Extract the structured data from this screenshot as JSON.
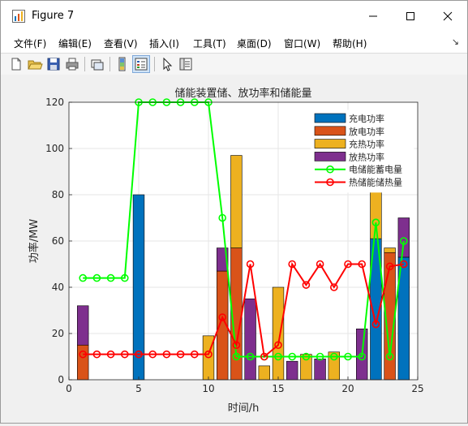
{
  "window": {
    "title": "Figure 7",
    "minimize": "minimize",
    "maximize": "maximize",
    "close": "close"
  },
  "menu": [
    {
      "label": "文件(F)"
    },
    {
      "label": "编辑(E)"
    },
    {
      "label": "查看(V)"
    },
    {
      "label": "插入(I)"
    },
    {
      "label": "工具(T)"
    },
    {
      "label": "桌面(D)"
    },
    {
      "label": "窗口(W)"
    },
    {
      "label": "帮助(H)"
    }
  ],
  "toolbar": [
    {
      "name": "new-figure-icon"
    },
    {
      "name": "open-file-icon"
    },
    {
      "name": "save-icon"
    },
    {
      "name": "print-icon"
    },
    {
      "name": "link-plot-icon"
    },
    {
      "name": "insert-colorbar-icon"
    },
    {
      "name": "insert-legend-icon"
    },
    {
      "name": "edit-plot-icon"
    },
    {
      "name": "property-inspector-icon"
    }
  ],
  "colors": {
    "charge_power": "#0072BD",
    "discharge_power": "#D95319",
    "heat_charge_power": "#EDB120",
    "heat_discharge_power": "#7E2F8E",
    "storage_electric": "#00FF00",
    "storage_heat": "#FF0000"
  },
  "chart_data": {
    "type": "bar",
    "title": "储能装置储、放功率和储能量",
    "xlabel": "时间/h",
    "ylabel": "功率/MW",
    "xlim": [
      0,
      25
    ],
    "ylim": [
      0,
      120
    ],
    "xticks": [
      0,
      5,
      10,
      15,
      20,
      25
    ],
    "yticks": [
      0,
      20,
      40,
      60,
      80,
      100,
      120
    ],
    "grid": true,
    "legend_position": "top-right",
    "x": [
      1,
      2,
      3,
      4,
      5,
      6,
      7,
      8,
      9,
      10,
      11,
      12,
      13,
      14,
      15,
      16,
      17,
      18,
      19,
      20,
      21,
      22,
      23,
      24
    ],
    "stacked_series": [
      {
        "name": "充电功率",
        "values": [
          0,
          0,
          0,
          0,
          80,
          0,
          0,
          0,
          0,
          0,
          0,
          0,
          0,
          0,
          0,
          0,
          0,
          0,
          0,
          0,
          0,
          61,
          0,
          53
        ]
      },
      {
        "name": "放电功率",
        "values": [
          15,
          0,
          0,
          0,
          0,
          0,
          0,
          0,
          0,
          0,
          47,
          57,
          0,
          0,
          0,
          0,
          0,
          0,
          0,
          0,
          0,
          0,
          55,
          0
        ]
      },
      {
        "name": "充热功率",
        "values": [
          0,
          0,
          0,
          0,
          0,
          0,
          0,
          0,
          0,
          19,
          0,
          40,
          0,
          6,
          40,
          0,
          11,
          0,
          12,
          0,
          0,
          29,
          2,
          0
        ]
      },
      {
        "name": "放热功率",
        "values": [
          17,
          0,
          0,
          0,
          0,
          0,
          0,
          0,
          0,
          0,
          10,
          0,
          35,
          0,
          0,
          8,
          0,
          9,
          0,
          0,
          22,
          0,
          0,
          17
        ]
      }
    ],
    "line_series": [
      {
        "name": "电储能蓄电量",
        "values": [
          44,
          44,
          44,
          44,
          120,
          120,
          120,
          120,
          120,
          120,
          70,
          10,
          10,
          10,
          10,
          10,
          10,
          10,
          10,
          10,
          10,
          68,
          10,
          60
        ]
      },
      {
        "name": "热储能储热量",
        "values": [
          11,
          11,
          11,
          11,
          11,
          11,
          11,
          11,
          11,
          11,
          27,
          15,
          50,
          10,
          15,
          50,
          41,
          50,
          40,
          50,
          50,
          24,
          49,
          50
        ]
      }
    ]
  }
}
